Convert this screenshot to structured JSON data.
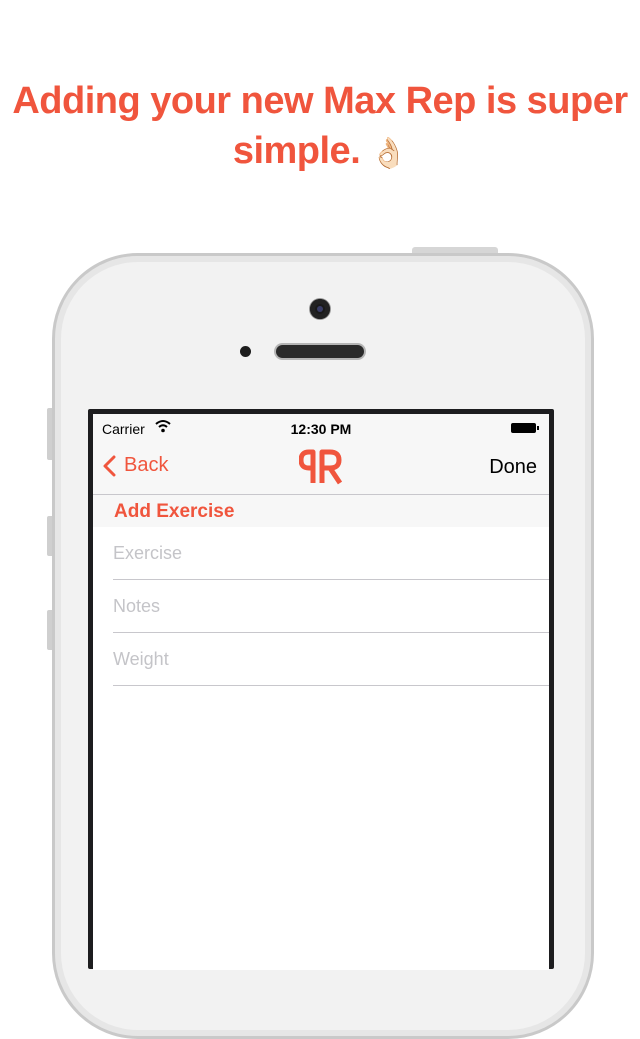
{
  "headline": {
    "line1": "Adding your new Max Rep is super",
    "line2": "simple.",
    "emoji": "👌🏻"
  },
  "status_bar": {
    "carrier": "Carrier",
    "time": "12:30 PM"
  },
  "nav": {
    "back_label": "Back",
    "done_label": "Done",
    "logo_text": "RR"
  },
  "form": {
    "section_title": "Add Exercise",
    "fields": [
      {
        "placeholder": "Exercise",
        "value": ""
      },
      {
        "placeholder": "Notes",
        "value": ""
      },
      {
        "placeholder": "Weight",
        "value": ""
      }
    ]
  },
  "colors": {
    "accent": "#f0553d",
    "background": "#ffffff",
    "bar": "#f7f7f7",
    "separator": "#c8c7cc"
  },
  "icons": [
    "wifi-icon",
    "battery-icon",
    "chevron-left-icon",
    "app-logo-icon",
    "ok-hand-emoji"
  ]
}
